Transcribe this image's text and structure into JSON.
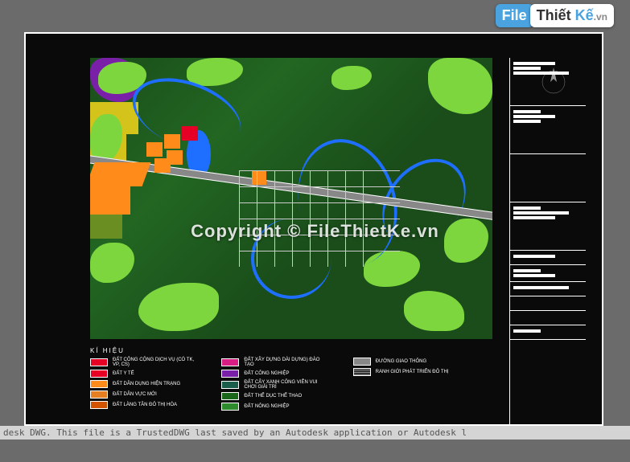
{
  "watermark": {
    "file": "File",
    "thiet": "Thiết",
    "ke": "Kế",
    "vn": ".vn"
  },
  "copyright_text": "Copyright © FileThietKe.vn",
  "status_bar": "desk DWG.  This file is a TrustedDWG last saved by an Autodesk application or Autodesk l",
  "legend": {
    "title": "KÍ HIỆU",
    "col1": [
      "ĐẤT CÔNG CỘNG DỊCH VỤ (CÓ TK, VP, CS)",
      "ĐẤT Y TẾ",
      "ĐẤT DÂN DỤNG HIỆN TRẠNG",
      "ĐẤT DÂN VỰC MỚI",
      "ĐẤT LÀNG TÂN ĐÔ THỊ HÓA"
    ],
    "col2": [
      "ĐẤT XÂY DỰNG DÀI DỰNG) ĐÀO TẠO",
      "ĐẤT CÔNG NGHIỆP",
      "ĐẤT CÂY XANH CÔNG VIÊN VUI CHƠI GIẢI TRÍ",
      "ĐẤT THỂ DỤC THỂ THAO",
      "ĐẤT NÔNG NGHIỆP"
    ],
    "col3": [
      "ĐƯỜNG GIAO THÔNG",
      "RANH GIỚI PHÁT TRIỂN ĐÔ THỊ"
    ]
  },
  "title_block": {
    "sec_a": [
      "██████",
      "███",
      "████████"
    ],
    "sec_b": [
      "████",
      "██████",
      "████"
    ],
    "sec_c": "",
    "sec_d": [
      "███",
      "████████████",
      "███ ███"
    ],
    "sec_e": "████████",
    "sec_f": [
      "███",
      "██████"
    ],
    "sec_g": "█████████████████████",
    "sec_h": ""
  }
}
